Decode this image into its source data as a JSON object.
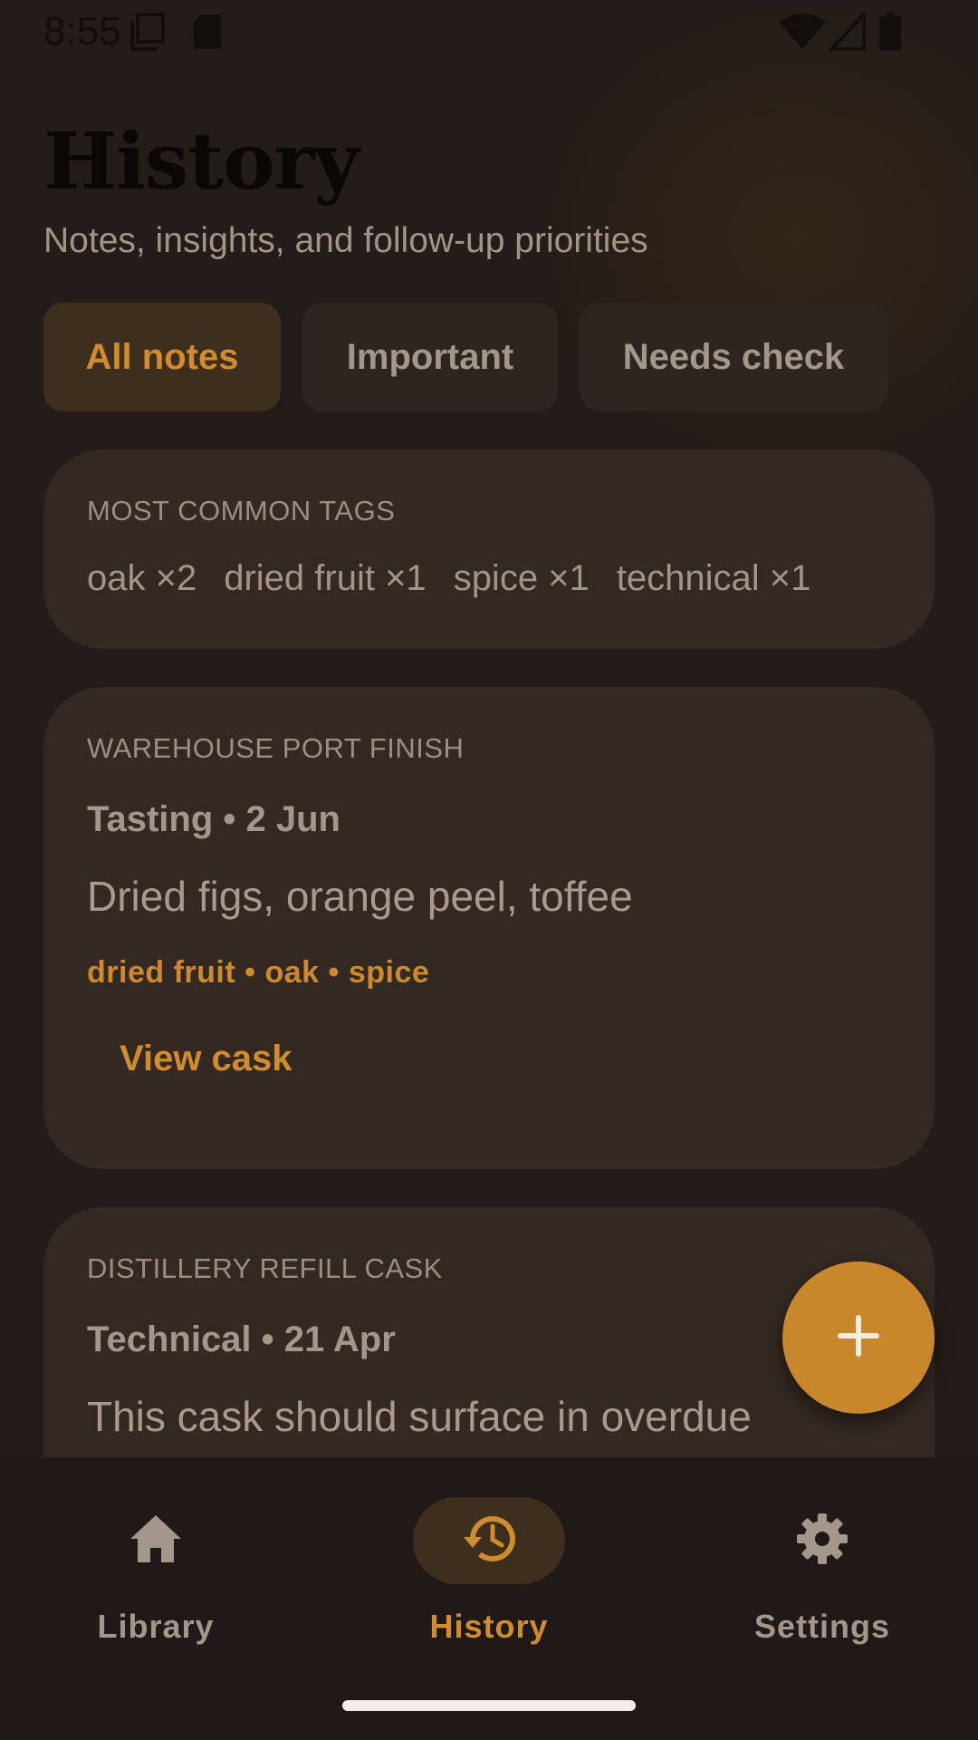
{
  "status_bar": {
    "time": "8:55",
    "icons": [
      "screenshot-icon",
      "sd-card-icon",
      "wifi-icon",
      "signal-icon",
      "battery-icon"
    ]
  },
  "header": {
    "title": "History",
    "subtitle": "Notes, insights, and follow-up priorities"
  },
  "filters": [
    {
      "label": "All notes",
      "selected": true
    },
    {
      "label": "Important",
      "selected": false
    },
    {
      "label": "Needs check",
      "selected": false
    }
  ],
  "common_tags": {
    "heading": "MOST COMMON TAGS",
    "tags": [
      "oak ×2",
      "dried fruit ×1",
      "spice ×1",
      "technical ×1"
    ]
  },
  "notes": [
    {
      "cask": "WAREHOUSE PORT FINISH",
      "meta": "Tasting • 2 Jun",
      "body": "Dried figs, orange peel, toffee",
      "tags": "dried fruit • oak • spice",
      "action": "View cask"
    },
    {
      "cask": "DISTILLERY REFILL CASK",
      "meta": "Technical • 21 Apr",
      "body": "This cask should surface in overdue"
    }
  ],
  "fab": {
    "icon": "plus-icon"
  },
  "bottom_nav": [
    {
      "label": "Library",
      "icon": "home-icon",
      "selected": false
    },
    {
      "label": "History",
      "icon": "history-icon",
      "selected": true
    },
    {
      "label": "Settings",
      "icon": "gear-icon",
      "selected": false
    }
  ],
  "colors": {
    "background": "#241c18",
    "card": "#342822",
    "accent": "#d08c2e",
    "fab": "#c8872a"
  }
}
